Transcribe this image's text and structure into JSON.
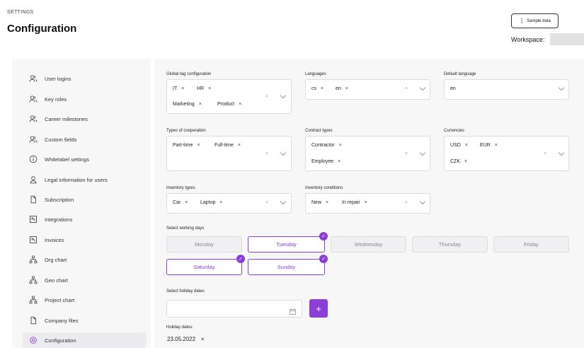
{
  "header": {
    "section": "SETTINGS",
    "title": "Configuration",
    "sample_data": "Sample data",
    "workspace_label": "Workspace:"
  },
  "sidebar": {
    "items": [
      {
        "label": "User logins",
        "icon": "users-icon"
      },
      {
        "label": "Key roles",
        "icon": "users-icon"
      },
      {
        "label": "Career milestones",
        "icon": "users-icon"
      },
      {
        "label": "Custom fields",
        "icon": "users-icon"
      },
      {
        "label": "Whitelabel settings",
        "icon": "info-icon"
      },
      {
        "label": "Legal information for users",
        "icon": "user-shield-icon"
      },
      {
        "label": "Subscription",
        "icon": "file-icon"
      },
      {
        "label": "Integrations",
        "icon": "integration-icon"
      },
      {
        "label": "Invoices",
        "icon": "invoice-icon"
      },
      {
        "label": "Org chart",
        "icon": "hierarchy-icon"
      },
      {
        "label": "Geo chart",
        "icon": "hierarchy-icon"
      },
      {
        "label": "Project chart",
        "icon": "hierarchy-icon"
      },
      {
        "label": "Company files",
        "icon": "file-icon"
      },
      {
        "label": "Configuration",
        "icon": "gear-icon",
        "active": true
      }
    ]
  },
  "form": {
    "global_tags": {
      "label": "Global tag configuration",
      "tags": [
        "IT",
        "HR",
        "Marketing",
        "Product"
      ]
    },
    "languages": {
      "label": "Languages",
      "tags": [
        "cs",
        "en"
      ]
    },
    "default_language": {
      "label": "Default language",
      "value": "en"
    },
    "cooperation": {
      "label": "Types of cooperation",
      "tags": [
        "Part-time",
        "Full-time"
      ]
    },
    "contract_types": {
      "label": "Contract types",
      "tags": [
        "Contractor",
        "Employee"
      ]
    },
    "currencies": {
      "label": "Currencies",
      "tags": [
        "USD",
        "EUR",
        "CZK"
      ]
    },
    "inventory_types": {
      "label": "Inventory types",
      "tags": [
        "Car",
        "Laptop"
      ]
    },
    "inventory_conditions": {
      "label": "Inventory conditions",
      "tags": [
        "New",
        "In repair"
      ]
    },
    "tag_remove": "×",
    "working_days": {
      "label": "Select working days",
      "days": [
        {
          "name": "Monday",
          "selected": false
        },
        {
          "name": "Tuesday",
          "selected": true
        },
        {
          "name": "Wednesday",
          "selected": false
        },
        {
          "name": "Thursday",
          "selected": false
        },
        {
          "name": "Friday",
          "selected": false
        },
        {
          "name": "Saturday",
          "selected": true
        },
        {
          "name": "Sunday",
          "selected": true
        }
      ]
    },
    "holiday": {
      "label": "Select holiday dates",
      "add": "+",
      "list_label": "Holiday dates:",
      "dates": [
        "23.05.2022"
      ]
    }
  },
  "colors": {
    "accent": "#8b3fd6"
  }
}
